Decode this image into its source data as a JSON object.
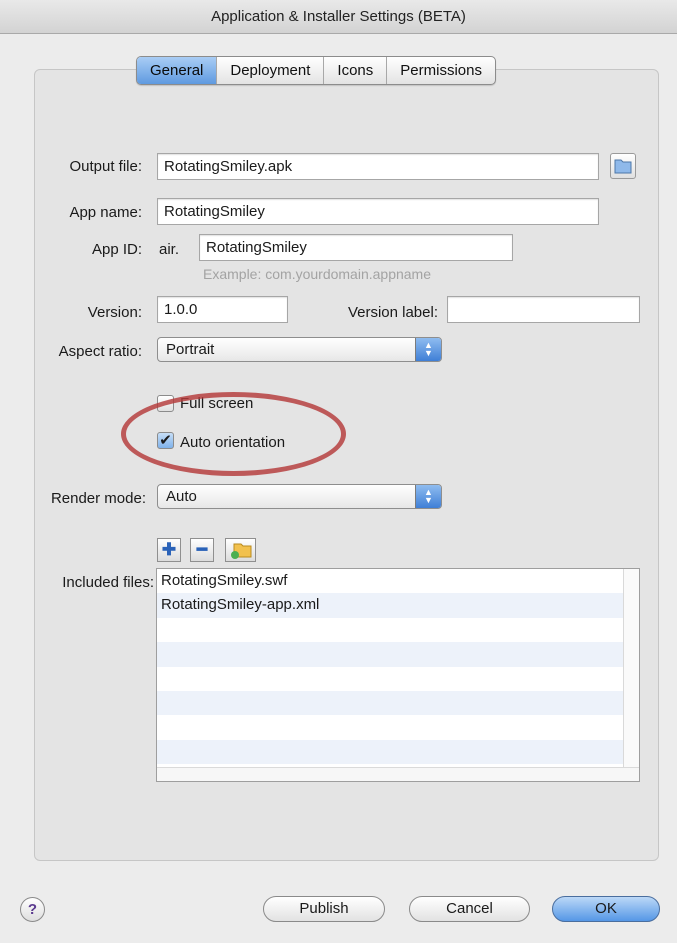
{
  "window": {
    "title": "Application & Installer Settings (BETA)"
  },
  "tabs": [
    {
      "label": "General",
      "active": true
    },
    {
      "label": "Deployment",
      "active": false
    },
    {
      "label": "Icons",
      "active": false
    },
    {
      "label": "Permissions",
      "active": false
    }
  ],
  "form": {
    "output_file": {
      "label": "Output file:",
      "value": "RotatingSmiley.apk"
    },
    "app_name": {
      "label": "App name:",
      "value": "RotatingSmiley"
    },
    "app_id": {
      "label": "App ID:",
      "prefix": "air.",
      "value": "RotatingSmiley",
      "hint": "Example: com.yourdomain.appname"
    },
    "version": {
      "label": "Version:",
      "value": "1.0.0"
    },
    "version_label": {
      "label": "Version label:",
      "value": ""
    },
    "aspect_ratio": {
      "label": "Aspect ratio:",
      "selected": "Portrait"
    },
    "full_screen": {
      "label": "Full screen",
      "checked": false
    },
    "auto_orientation": {
      "label": "Auto orientation",
      "checked": true
    },
    "render_mode": {
      "label": "Render mode:",
      "selected": "Auto"
    },
    "included_files": {
      "label": "Included files:",
      "items": [
        "RotatingSmiley.swf",
        "RotatingSmiley-app.xml",
        "",
        "",
        "",
        "",
        "",
        ""
      ]
    }
  },
  "buttons": {
    "publish": "Publish",
    "cancel": "Cancel",
    "ok": "OK",
    "help": "?"
  },
  "icons": {
    "browse": "folder-icon",
    "add": "plus-icon",
    "remove": "minus-icon",
    "add_folder": "add-folder-icon"
  },
  "colors": {
    "highlight_oval": "#b53a3a",
    "accent_blue": "#5f9ae0"
  }
}
